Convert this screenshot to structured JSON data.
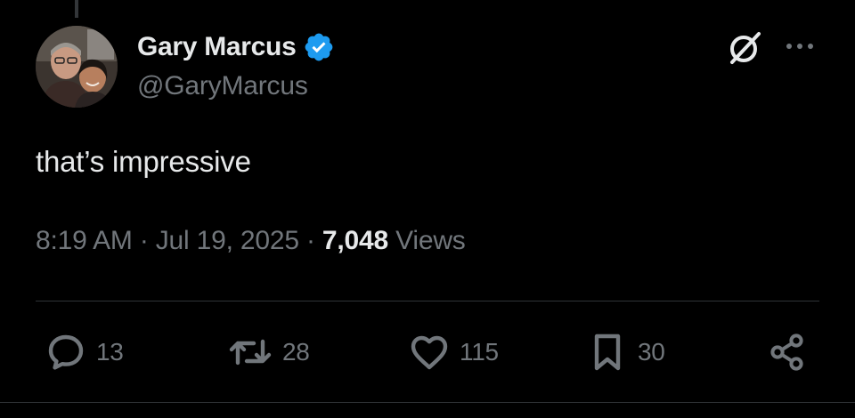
{
  "author": {
    "display_name": "Gary Marcus",
    "handle": "@GaryMarcus",
    "verified": true,
    "verified_color": "#1d9bf0"
  },
  "tweet": {
    "text": "that’s impressive",
    "time": "8:19 AM",
    "date": "Jul 19, 2025",
    "separator": "·",
    "views_count": "7,048",
    "views_label": "Views"
  },
  "actions": {
    "replies": "13",
    "reposts": "28",
    "likes": "115",
    "bookmarks": "30"
  },
  "icons": {
    "top_right": [
      "grok-icon",
      "more-icon"
    ],
    "actions": [
      "reply-icon",
      "repost-icon",
      "like-icon",
      "bookmark-icon",
      "share-icon"
    ]
  },
  "colors": {
    "background": "#000000",
    "primary_text": "#e7e9ea",
    "secondary_text": "#71767b",
    "divider": "#2f3336"
  }
}
